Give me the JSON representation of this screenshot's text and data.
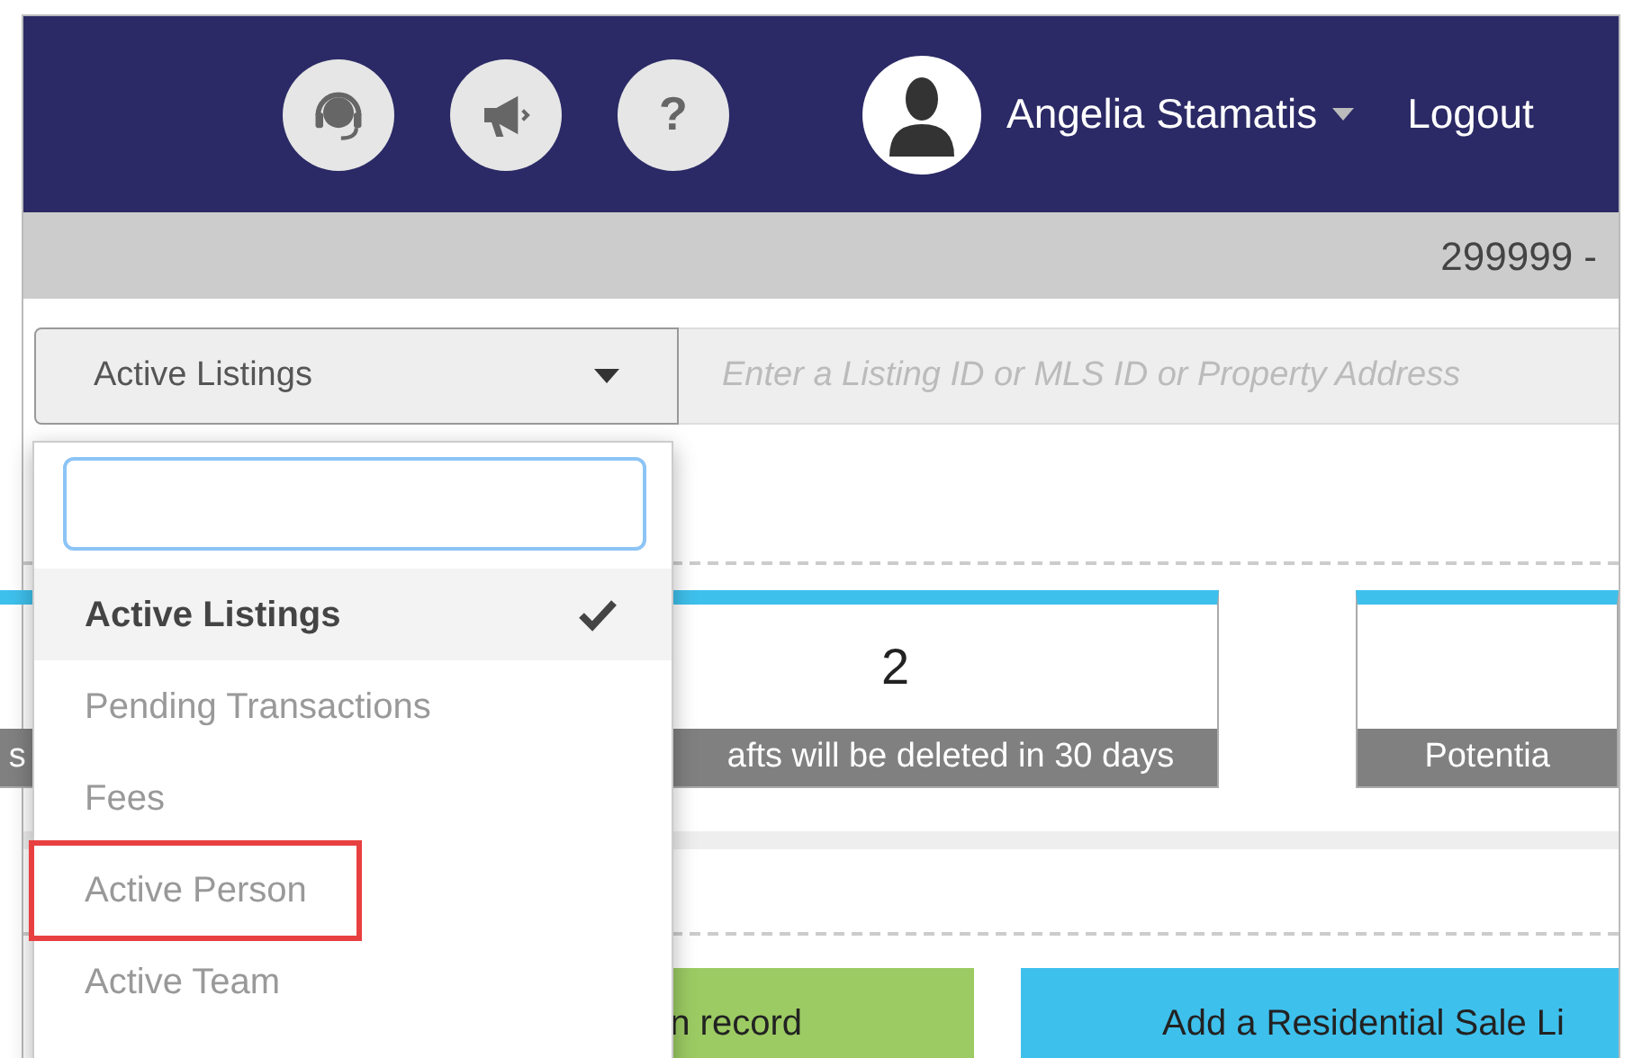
{
  "header": {
    "icons": [
      {
        "kind": "headset"
      },
      {
        "kind": "megaphone"
      },
      {
        "kind": "help",
        "glyph": "?"
      }
    ],
    "user": {
      "name": "Angelia Stamatis"
    },
    "logout": "Logout"
  },
  "subheader": {
    "text": "299999 -"
  },
  "search_bar": {
    "filter": "Active Listings",
    "placeholder": "Enter a Listing ID or MLS ID or Property Address"
  },
  "dropdown": {
    "items": [
      {
        "label": "Active Listings",
        "selected": true,
        "highlighted": false
      },
      {
        "label": "Pending Transactions",
        "selected": false,
        "highlighted": false
      },
      {
        "label": "Fees",
        "selected": false,
        "highlighted": false
      },
      {
        "label": "Active Person",
        "selected": false,
        "highlighted": true
      },
      {
        "label": "Active Team",
        "selected": false,
        "highlighted": false
      }
    ]
  },
  "cards": [
    {
      "label": "s"
    },
    {
      "value": "2",
      "label": "afts will be deleted in 30 days"
    },
    {
      "label": "Potentia"
    }
  ],
  "actions": [
    {
      "label": "n record",
      "color": "#9ccb63"
    },
    {
      "label": "Add a Residential Sale Li",
      "color": "#3ec0ec"
    }
  ]
}
